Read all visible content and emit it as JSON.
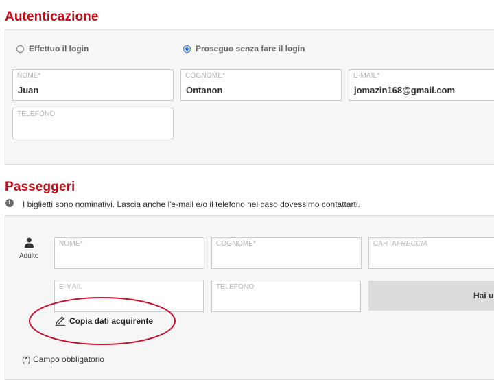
{
  "auth": {
    "title": "Autenticazione",
    "radio_login": "Effettuo il login",
    "radio_guest": "Proseguo senza fare il login",
    "fields": {
      "nome": {
        "label": "NOME*",
        "value": "Juan"
      },
      "cognome": {
        "label": "COGNOME*",
        "value": "Ontanon"
      },
      "email": {
        "label": "E-MAIL*",
        "value": "jomazin168@gmail.com"
      },
      "telefono": {
        "label": "TELEFONO",
        "value": ""
      }
    }
  },
  "passengers": {
    "title": "Passeggeri",
    "info": "I biglietti sono nominativi. Lascia anche l'e-mail e/o il telefono nel caso dovessimo contattarti.",
    "passenger_type": "Adulto",
    "fields": {
      "nome": {
        "label": "NOME*",
        "value": ""
      },
      "cognome": {
        "label": "COGNOME*",
        "value": ""
      },
      "carta_prefix": "CARTA",
      "carta_suffix": "FRECCIA",
      "email": {
        "label": "E-MAIL",
        "value": ""
      },
      "telefono": {
        "label": "TELEFONO",
        "value": ""
      }
    },
    "grey_button_label": "Hai u",
    "copy_link": "Copia dati acquirente",
    "required_note": "(*) Campo obbligatorio"
  },
  "colors": {
    "accent_red": "#c20e1a",
    "radio_blue": "#1a73e8",
    "annotation_red": "#c8102e"
  },
  "icons": [
    "info-icon",
    "user-icon",
    "pencil-icon"
  ]
}
